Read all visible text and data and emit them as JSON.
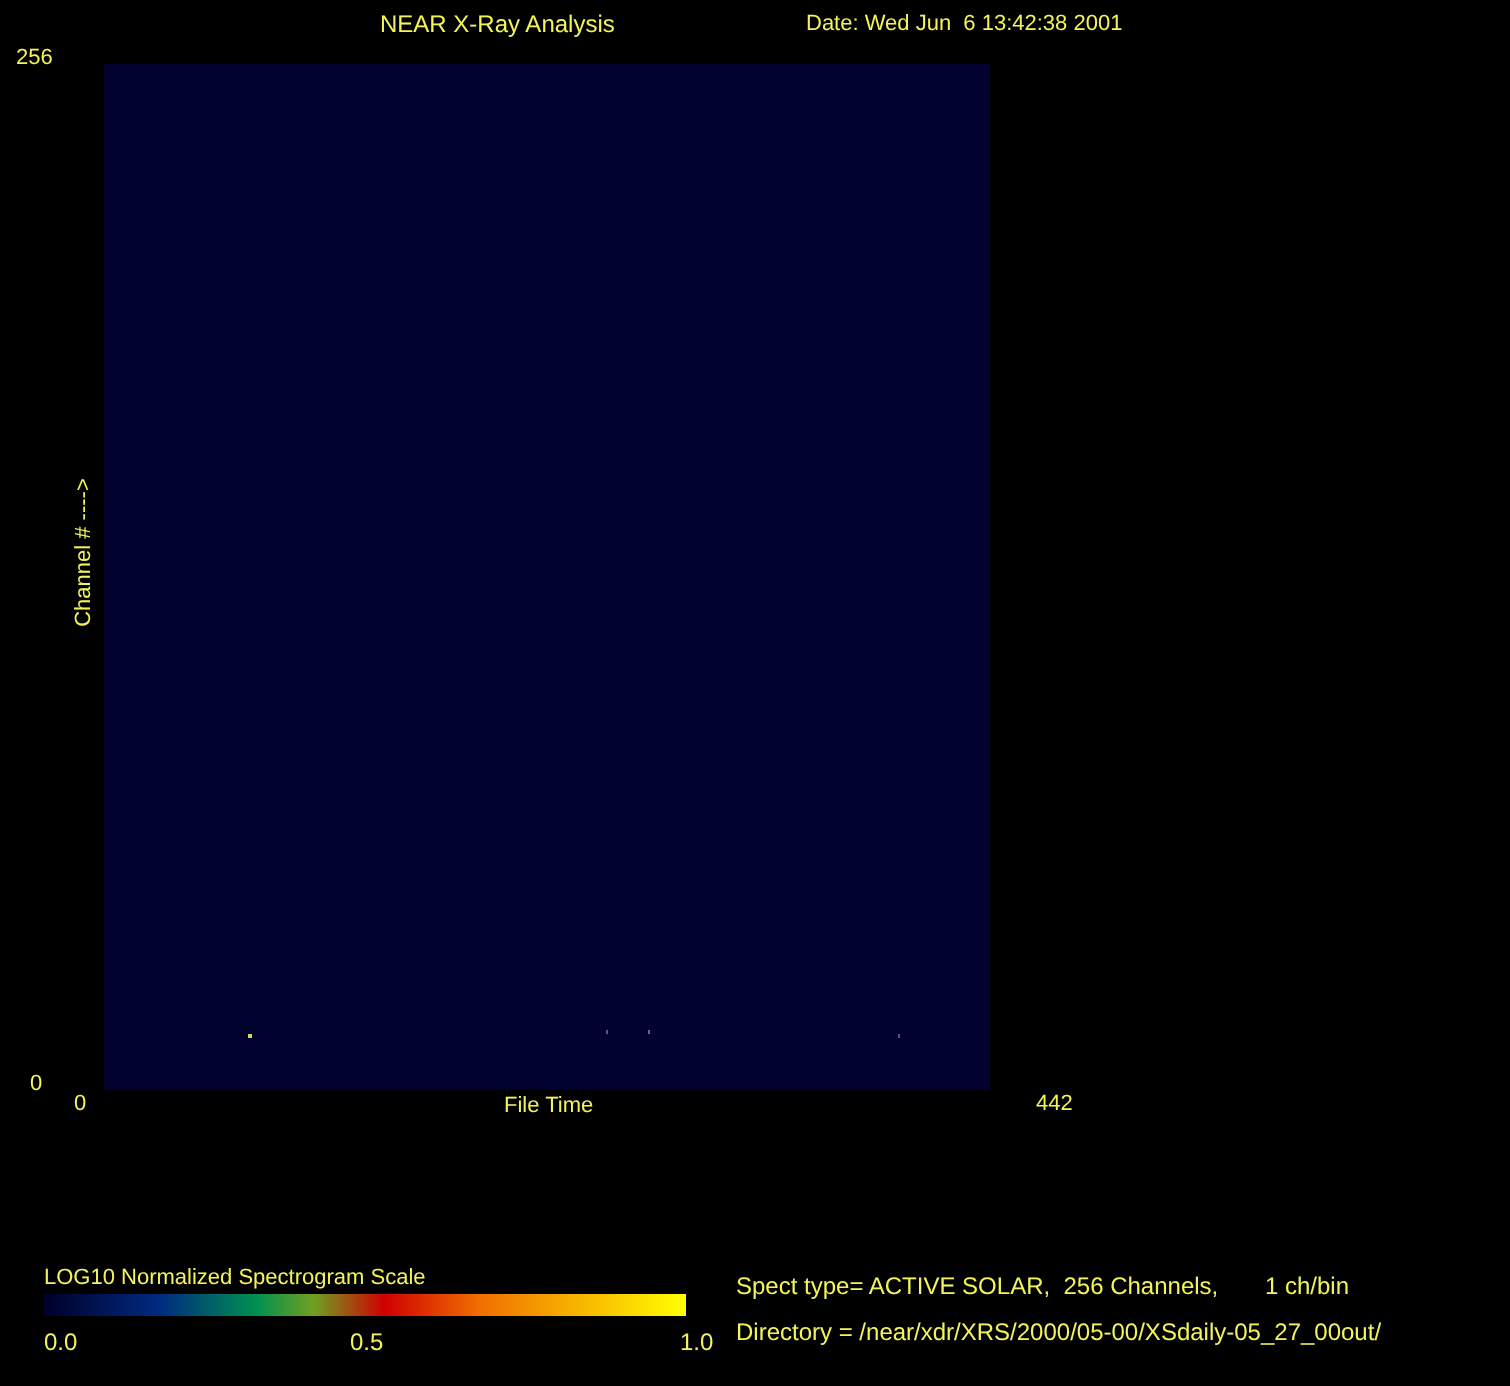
{
  "header": {
    "title": "NEAR X-Ray Analysis",
    "date": "Date: Wed Jun  6 13:42:38 2001"
  },
  "plot": {
    "y_axis": {
      "max": "256",
      "min": "0",
      "label": "Channel # ---->"
    },
    "x_axis": {
      "min": "0",
      "max": "442",
      "label": "File Time"
    }
  },
  "scale": {
    "title": "LOG10 Normalized Spectrogram Scale",
    "ticks": [
      "0.0",
      "0.5",
      "1.0"
    ]
  },
  "info": [
    "Spect type= ACTIVE SOLAR,  256 Channels,       1 ch/bin",
    "Directory = /near/xdr/XRS/2000/05-00/XSdaily-05_27_00out/"
  ]
}
